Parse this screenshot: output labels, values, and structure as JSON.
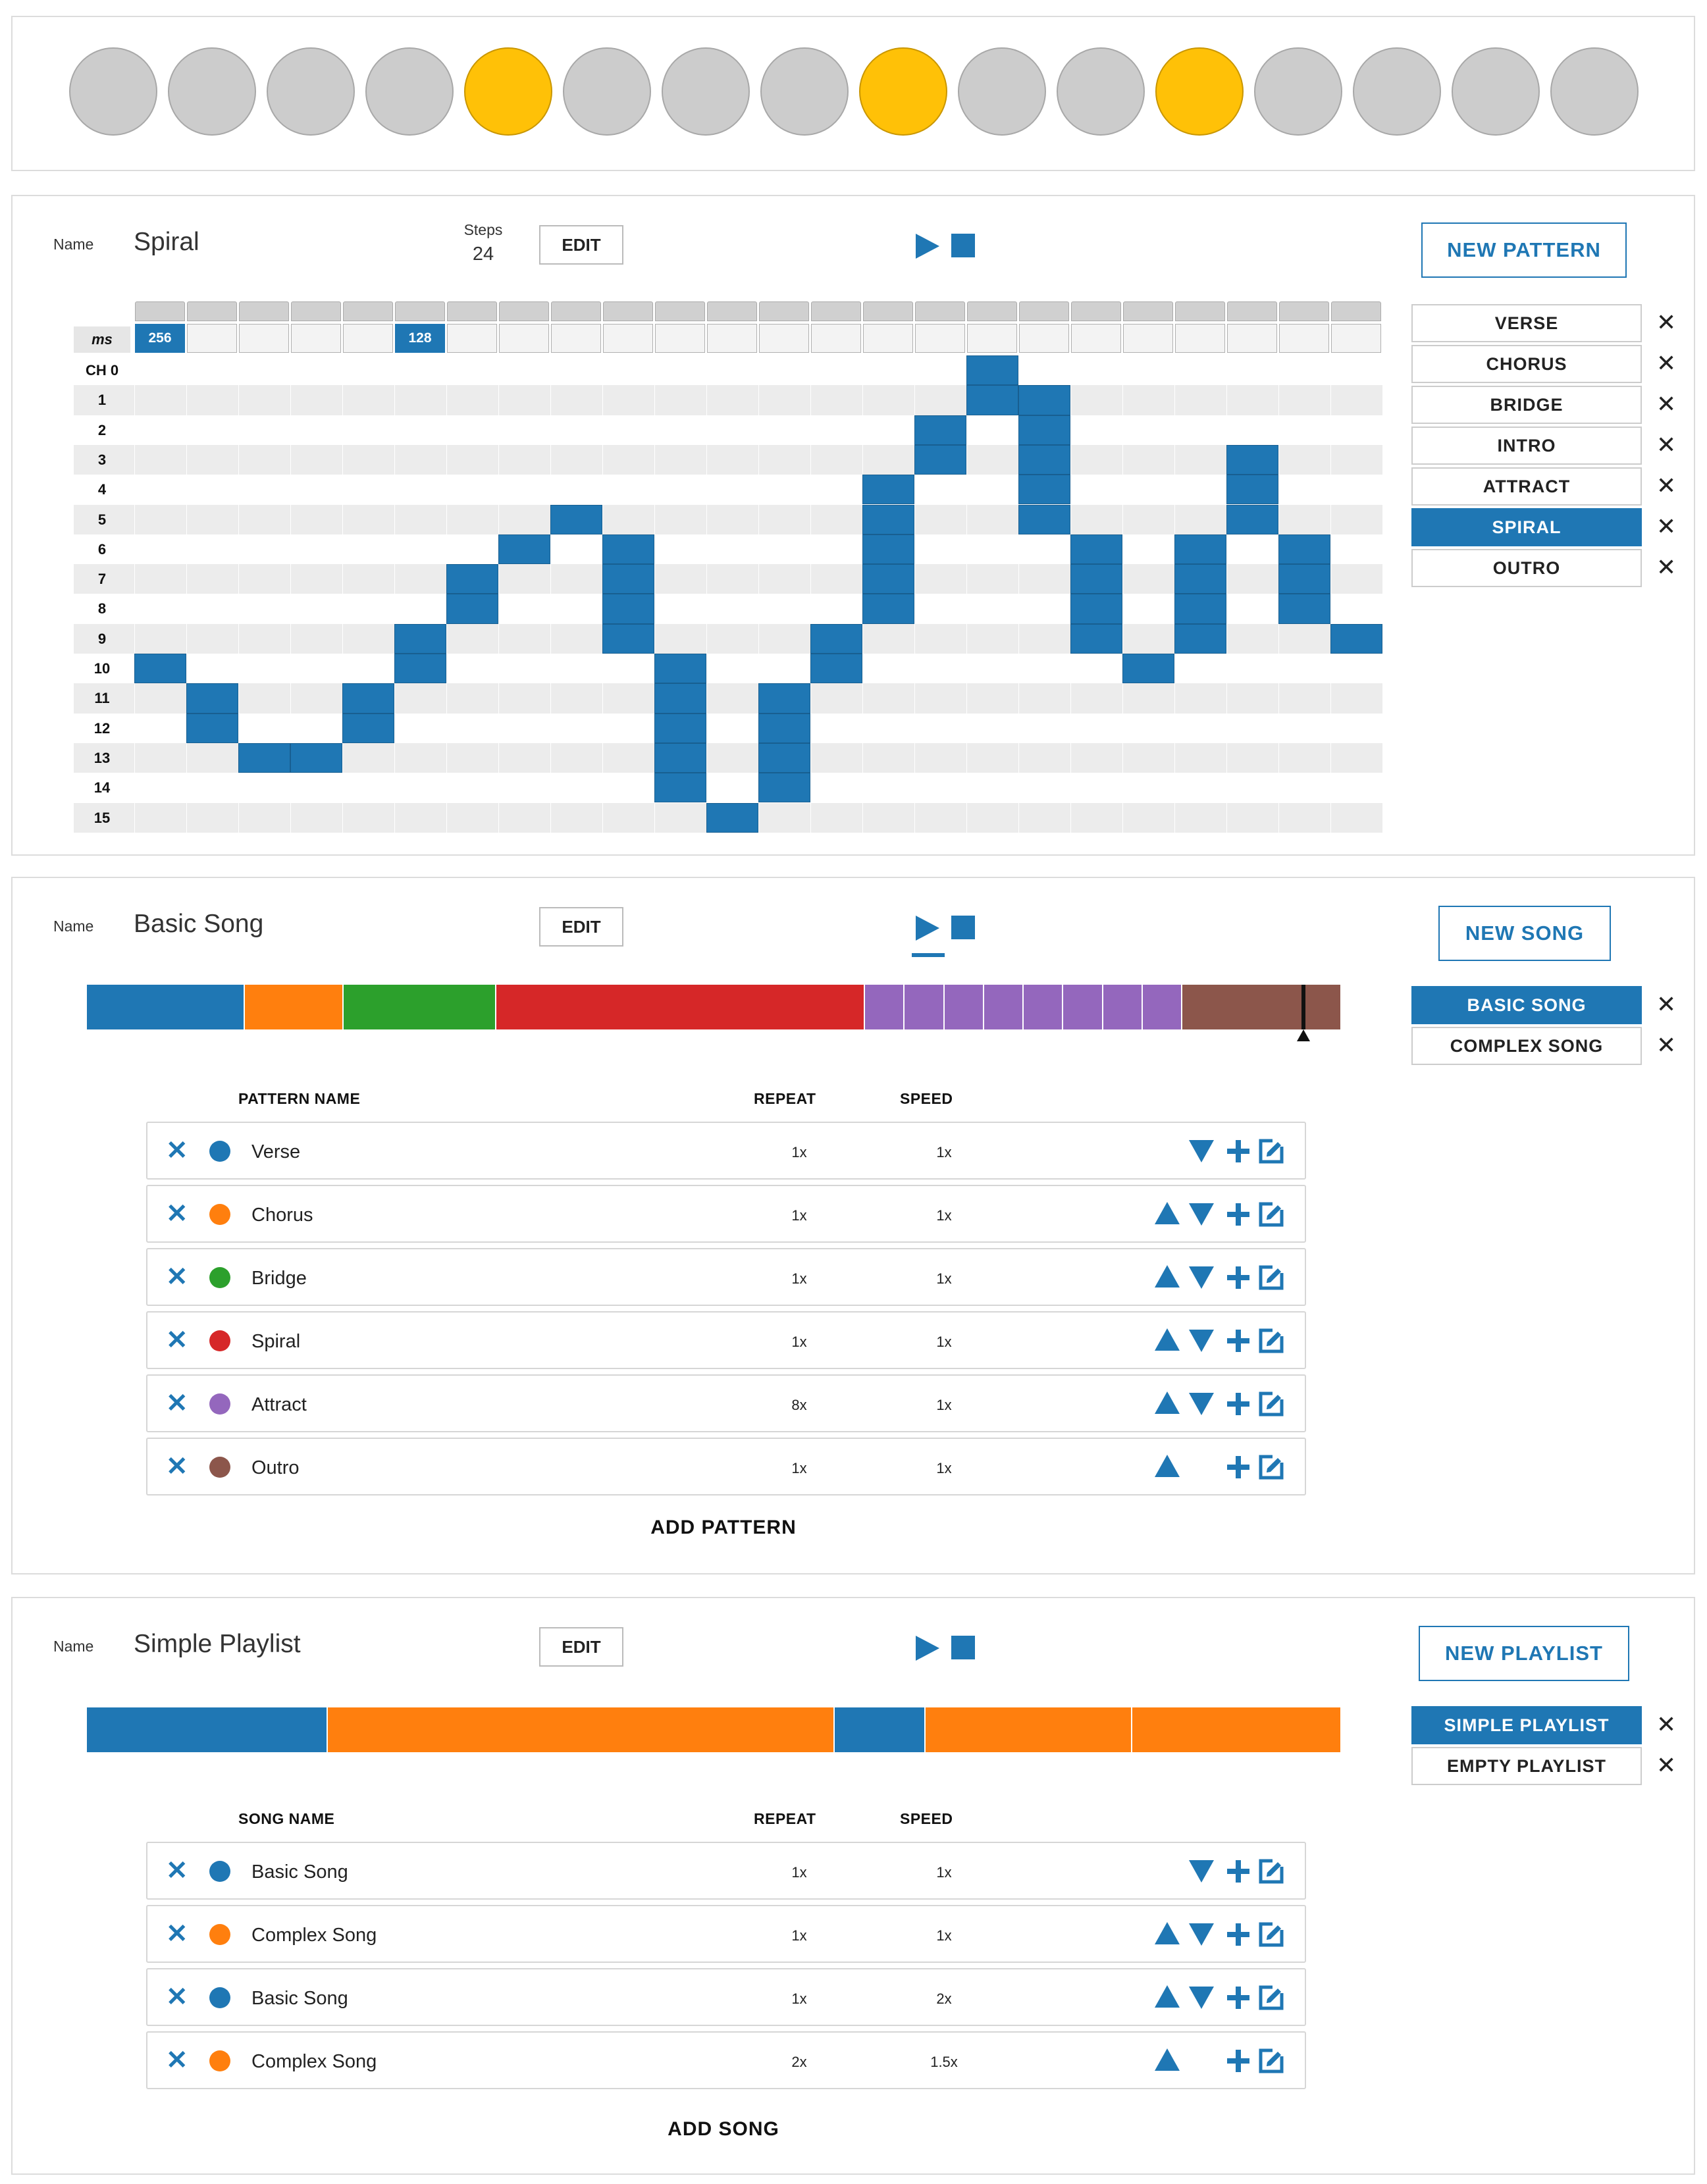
{
  "leds": [
    false,
    false,
    false,
    false,
    true,
    false,
    false,
    false,
    true,
    false,
    false,
    true,
    false,
    false,
    false,
    false
  ],
  "colors": {
    "accent": "#1f77b4",
    "led_on": "#ffc107",
    "led_off": "#cccccc"
  },
  "pattern": {
    "name_label": "Name",
    "name": "Spiral",
    "steps_label": "Steps",
    "steps": "24",
    "edit_label": "EDIT",
    "new_label": "NEW PATTERN",
    "ms_label": "ms",
    "ms_values": {
      "0": "256",
      "5": "128"
    },
    "row_labels": [
      "CH 0",
      "1",
      "2",
      "3",
      "4",
      "5",
      "6",
      "7",
      "8",
      "9",
      "10",
      "11",
      "12",
      "13",
      "14",
      "15"
    ],
    "active_channel_by_step": [
      10,
      11,
      13,
      13,
      11,
      9,
      7,
      6,
      5,
      6,
      10,
      15,
      11,
      9,
      4,
      2,
      0,
      1,
      6,
      10,
      6,
      3,
      6,
      9
    ],
    "list": [
      "VERSE",
      "CHORUS",
      "BRIDGE",
      "INTRO",
      "ATTRACT",
      "SPIRAL",
      "OUTRO"
    ],
    "selected": "SPIRAL"
  },
  "song": {
    "name_label": "Name",
    "name": "Basic Song",
    "edit_label": "EDIT",
    "new_label": "NEW SONG",
    "list": [
      "BASIC SONG",
      "COMPLEX SONG"
    ],
    "selected": "BASIC SONG",
    "timeline": [
      {
        "color": "#1f77b4",
        "weight": 1
      },
      {
        "color": "#ff7f0e",
        "weight": 1
      },
      {
        "color": "#2ca02c",
        "weight": 1
      },
      {
        "color": "#d62728",
        "weight": 1
      },
      {
        "color": "#9467bd",
        "weight": 8
      },
      {
        "color": "#8c564b",
        "weight": 1
      }
    ],
    "headers": {
      "name": "PATTERN NAME",
      "repeat": "REPEAT",
      "speed": "SPEED"
    },
    "rows": [
      {
        "name": "Verse",
        "color": "#1f77b4",
        "repeat": "1x",
        "speed": "1x",
        "up": false,
        "down": true
      },
      {
        "name": "Chorus",
        "color": "#ff7f0e",
        "repeat": "1x",
        "speed": "1x",
        "up": true,
        "down": true
      },
      {
        "name": "Bridge",
        "color": "#2ca02c",
        "repeat": "1x",
        "speed": "1x",
        "up": true,
        "down": true
      },
      {
        "name": "Spiral",
        "color": "#d62728",
        "repeat": "1x",
        "speed": "1x",
        "up": true,
        "down": true
      },
      {
        "name": "Attract",
        "color": "#9467bd",
        "repeat": "8x",
        "speed": "1x",
        "up": true,
        "down": true
      },
      {
        "name": "Outro",
        "color": "#8c564b",
        "repeat": "1x",
        "speed": "1x",
        "up": true,
        "down": false
      }
    ],
    "add_label": "ADD PATTERN"
  },
  "playlist": {
    "name_label": "Name",
    "name": "Simple Playlist",
    "edit_label": "EDIT",
    "new_label": "NEW PLAYLIST",
    "list": [
      "SIMPLE PLAYLIST",
      "EMPTY PLAYLIST"
    ],
    "selected": "SIMPLE PLAYLIST",
    "headers": {
      "name": "SONG NAME",
      "repeat": "REPEAT",
      "speed": "SPEED"
    },
    "rows": [
      {
        "name": "Basic Song",
        "color": "#1f77b4",
        "repeat": "1x",
        "speed": "1x",
        "up": false,
        "down": true
      },
      {
        "name": "Complex Song",
        "color": "#ff7f0e",
        "repeat": "1x",
        "speed": "1x",
        "up": true,
        "down": true
      },
      {
        "name": "Basic Song",
        "color": "#1f77b4",
        "repeat": "1x",
        "speed": "2x",
        "up": true,
        "down": true
      },
      {
        "name": "Complex Song",
        "color": "#ff7f0e",
        "repeat": "2x",
        "speed": "1.5x",
        "up": true,
        "down": false
      }
    ],
    "add_label": "ADD SONG"
  }
}
